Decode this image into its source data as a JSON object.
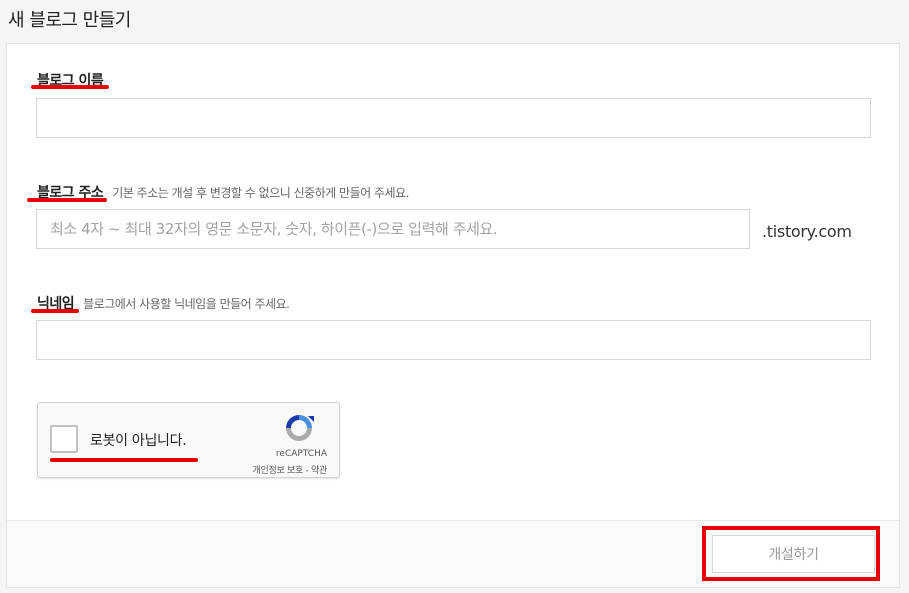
{
  "page": {
    "title": "새 블로그 만들기"
  },
  "form": {
    "blog_name": {
      "label": "블로그 이름",
      "value": "",
      "placeholder": ""
    },
    "blog_address": {
      "label": "블로그 주소",
      "help": "기본 주소는 개설 후 변경할 수 없으니 신중하게 만들어 주세요.",
      "value": "",
      "placeholder": "최소 4자 ~ 최대 32자의 영문 소문자, 숫자, 하이픈(-)으로 입력해 주세요.",
      "suffix": ".tistory.com"
    },
    "nickname": {
      "label": "닉네임",
      "help": "블로그에서 사용할 닉네임을 만들어 주세요.",
      "value": "",
      "placeholder": ""
    }
  },
  "recaptcha": {
    "label": "로봇이 아닙니다.",
    "brand": "reCAPTCHA",
    "terms": "개인정보 보호 - 약관",
    "checked": false
  },
  "footer": {
    "create_label": "개설하기"
  },
  "colors": {
    "annotation_red": "#e60000",
    "border": "#d6d6d6",
    "placeholder": "#a3a3a3"
  }
}
